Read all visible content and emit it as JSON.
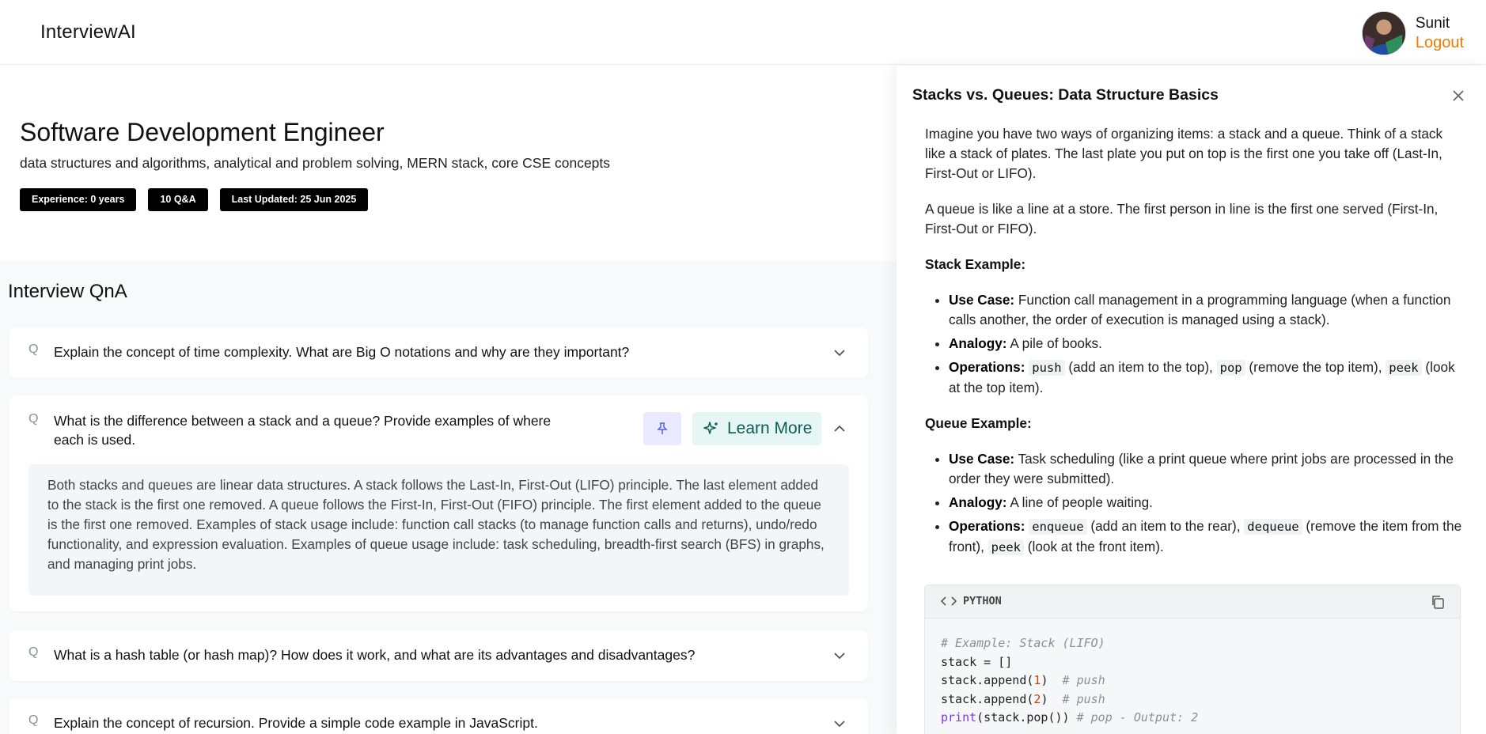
{
  "header": {
    "brand": "InterviewAI",
    "user_name": "Sunit",
    "logout_label": "Logout"
  },
  "role": {
    "title": "Software Development Engineer",
    "description": "data structures and algorithms, analytical and problem solving, MERN stack, core CSE concepts",
    "pills": [
      "Experience: 0 years",
      "10 Q&A",
      "Last Updated: 25 Jun 2025"
    ]
  },
  "qna": {
    "title": "Interview QnA",
    "q_icon": "Q",
    "questions": [
      {
        "text": "Explain the concept of time complexity. What are Big O notations and why are they important?",
        "expanded": false
      },
      {
        "text": "What is the difference between a stack and a queue? Provide examples of where each is used.",
        "expanded": true,
        "learn_more_label": "Learn More",
        "answer": "Both stacks and queues are linear data structures. A stack follows the Last-In, First-Out (LIFO) principle. The last element added to the stack is the first one removed. A queue follows the First-In, First-Out (FIFO) principle. The first element added to the queue is the first one removed. Examples of stack usage include: function call stacks (to manage function calls and returns), undo/redo functionality, and expression evaluation. Examples of queue usage include: task scheduling, breadth-first search (BFS) in graphs, and managing print jobs."
      },
      {
        "text": "What is a hash table (or hash map)? How does it work, and what are its advantages and disadvantages?",
        "expanded": false
      },
      {
        "text": "Explain the concept of recursion. Provide a simple code example in JavaScript.",
        "expanded": false
      }
    ]
  },
  "drawer": {
    "title": "Stacks vs. Queues: Data Structure Basics",
    "intro1": "Imagine you have two ways of organizing items: a stack and a queue. Think of a stack like a stack of plates. The last plate you put on top is the first one you take off (Last-In, First-Out or LIFO).",
    "intro2": "A queue is like a line at a store. The first person in line is the first one served (First-In, First-Out or FIFO).",
    "stack_heading": "Stack Example:",
    "stack": {
      "use_case_label": "Use Case:",
      "use_case": "Function call management in a programming language (when a function calls another, the order of execution is managed using a stack).",
      "analogy_label": "Analogy:",
      "analogy": "A pile of books.",
      "ops_label": "Operations:",
      "op1": "push",
      "op1_desc": "(add an item to the top),",
      "op2": "pop",
      "op2_desc": "(remove the top item),",
      "op3": "peek",
      "op3_desc": "(look at the top item)."
    },
    "queue_heading": "Queue Example:",
    "queue": {
      "use_case_label": "Use Case:",
      "use_case": "Task scheduling (like a print queue where print jobs are processed in the order they were submitted).",
      "analogy_label": "Analogy:",
      "analogy": "A line of people waiting.",
      "ops_label": "Operations:",
      "op1": "enqueue",
      "op1_desc": "(add an item to the rear),",
      "op2": "dequeue",
      "op2_desc": "(remove the item from the front),",
      "op3": "peek",
      "op3_desc": "(look at the front item)."
    },
    "code": {
      "language": "PYTHON",
      "line1": "# Example: Stack (LIFO)",
      "line2": "stack = []",
      "line3_code": "stack.append(",
      "line3_num": "1",
      "line3_end": ")  ",
      "line3_com": "# push",
      "line4_code": "stack.append(",
      "line4_num": "2",
      "line4_end": ")  ",
      "line4_com": "# push",
      "line5_fn": "print",
      "line5_code": "(stack.pop()) ",
      "line5_com": "# pop - Output: 2"
    }
  },
  "colors": {
    "accent_orange": "#f07a00",
    "learn_more_bg": "#e6f6f4",
    "learn_more_fg": "#0f5c55",
    "pin_bg": "#e9eaff",
    "pill_bg": "#000000"
  },
  "icons": {
    "close": "close-icon",
    "chevron_down": "chevron-down-icon",
    "chevron_up": "chevron-up-icon",
    "pin": "pin-icon",
    "sparkle": "sparkle-icon",
    "code": "code-icon",
    "copy": "copy-icon"
  }
}
